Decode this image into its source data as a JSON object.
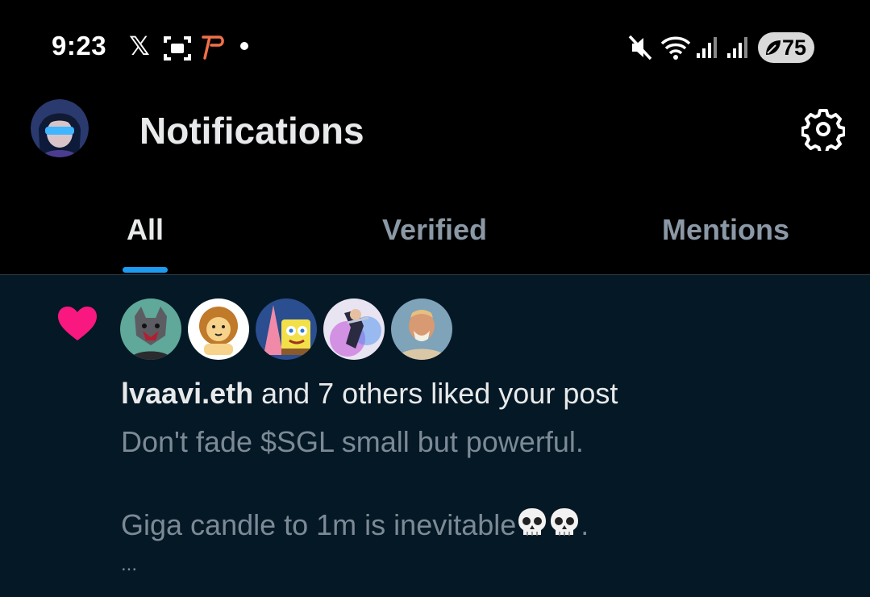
{
  "status_bar": {
    "time": "9:23",
    "x_glyph": "𝕏",
    "battery_percent": "75",
    "icons": [
      "x-logo-icon",
      "screenshot-icon",
      "p-app-icon",
      "notification-dot-icon",
      "mute-icon",
      "wifi-icon",
      "signal-icon",
      "signal-icon",
      "battery-saver-icon"
    ]
  },
  "header": {
    "title": "Notifications"
  },
  "tabs": [
    {
      "label": "All",
      "active": true
    },
    {
      "label": "Verified",
      "active": false
    },
    {
      "label": "Mentions",
      "active": false
    }
  ],
  "notification": {
    "type": "like",
    "actor": "lvaavi.eth",
    "summary_rest": " and 7 others liked your post",
    "post_line1": "Don't fade $SGL small but powerful.",
    "post_line2": "Giga candle to 1m is inevitable",
    "post_line2_suffix": ".",
    "ellipsis": "...",
    "avatar_count": 5
  },
  "colors": {
    "background": "#000000",
    "notification_bg": "#051825",
    "accent": "#1d9bf0",
    "like": "#f91880",
    "muted_text": "#7c8a96",
    "tab_inactive": "#8b98a5"
  }
}
